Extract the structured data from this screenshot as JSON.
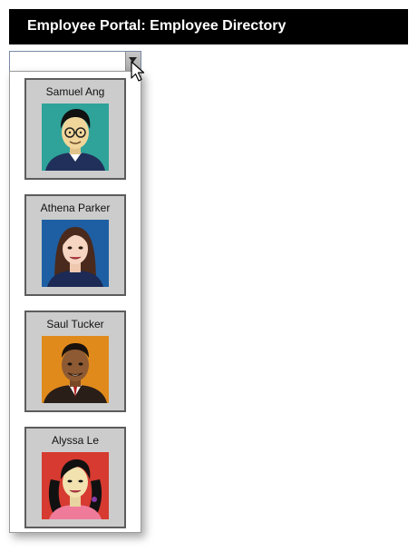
{
  "header": {
    "title": "Employee Portal: Employee Directory"
  },
  "combo": {
    "value": "",
    "placeholder": ""
  },
  "employees": [
    {
      "name": "Samuel Ang",
      "portrait_icon": "man-glasses-portrait",
      "bg_color": "#2fa39a"
    },
    {
      "name": "Athena Parker",
      "portrait_icon": "woman-portrait",
      "bg_color": "#1e5fa3"
    },
    {
      "name": "Saul Tucker",
      "portrait_icon": "man-suit-portrait",
      "bg_color": "#e08a1c"
    },
    {
      "name": "Alyssa Le",
      "portrait_icon": "woman-pigtails-portrait",
      "bg_color": "#d63a30"
    }
  ],
  "colors": {
    "header_bg": "#000000",
    "header_text": "#ffffff",
    "card_bg": "#cccccc",
    "card_border": "#5c5c5c"
  }
}
